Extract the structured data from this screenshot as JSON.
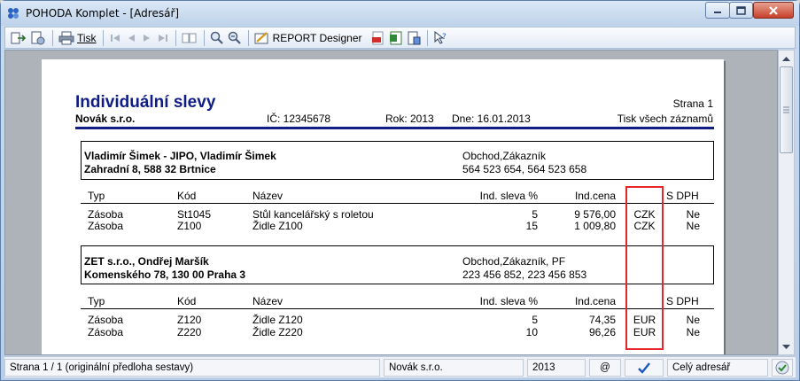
{
  "window": {
    "title": "POHODA Komplet - [Adresář]"
  },
  "toolbar": {
    "print_label": "Tisk",
    "designer_label": "REPORT Designer"
  },
  "report": {
    "title": "Individuální slevy",
    "page": "Strana 1",
    "company": "Novák  s.r.o.",
    "ic": "IČ: 12345678",
    "rok": "Rok: 2013",
    "dne": "Dne: 16.01.2013",
    "scope": "Tisk všech záznamů",
    "columns": [
      "Typ",
      "Kód",
      "Název",
      "Ind. sleva %",
      "Ind.cena",
      "",
      "S DPH"
    ],
    "groups": [
      {
        "name": "Vladimír Šimek - JIPO, Vladimír Šimek",
        "address": "Zahradní 8, 588 32 Brtnice",
        "roles": "Obchod,Zákazník",
        "phones": "564 523 654, 564 523 658",
        "rows": [
          [
            "Zásoba",
            "St1045",
            "Stůl kancelářský s roletou",
            "5",
            "9 576,00",
            "CZK",
            "Ne"
          ],
          [
            "Zásoba",
            "Z100",
            "Židle Z100",
            "15",
            "1 009,80",
            "CZK",
            "Ne"
          ]
        ]
      },
      {
        "name": "ZET s.r.o., Ondřej Maršík",
        "address": "Komenského 78, 130 00 Praha 3",
        "roles": "Obchod,Zákazník, PF",
        "phones": "223 456 852, 223 456 853",
        "rows": [
          [
            "Zásoba",
            "Z120",
            "Židle Z120",
            "5",
            "74,35",
            "EUR",
            "Ne"
          ],
          [
            "Zásoba",
            "Z220",
            "Židle Z220",
            "10",
            "96,26",
            "EUR",
            "Ne"
          ]
        ]
      }
    ]
  },
  "statusbar": {
    "page_info": "Strana 1 / 1  (originální předloha sestavy)",
    "company": "Novák  s.r.o.",
    "year": "2013",
    "at": "@",
    "scope": "Celý adresář"
  },
  "colors": {
    "report_title": "#0f1d85",
    "highlight": "#e8262a"
  }
}
